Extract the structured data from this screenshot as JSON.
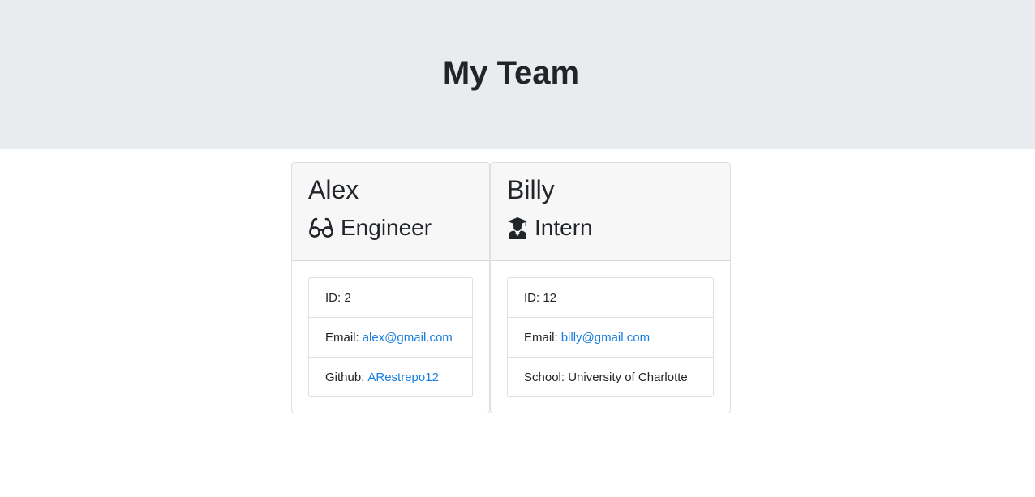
{
  "header": {
    "title": "My Team"
  },
  "members": [
    {
      "name": "Alex",
      "role": "Engineer",
      "role_icon": "glasses-icon",
      "fields": [
        {
          "label": "ID: 2",
          "value": ""
        },
        {
          "label": "Email:",
          "value": "alex@gmail.com"
        },
        {
          "label": "Github:",
          "value": "ARestrepo12"
        }
      ]
    },
    {
      "name": "Billy",
      "role": "Intern",
      "role_icon": "graduate-icon",
      "fields": [
        {
          "label": "ID: 12",
          "value": ""
        },
        {
          "label": "Email:",
          "value": "billy@gmail.com"
        },
        {
          "label": "School: University of Charlotte",
          "value": ""
        }
      ]
    }
  ],
  "colors": {
    "header_bg": "#e9ecef",
    "card_header_bg": "#f7f7f7",
    "link": "#1a7ee0",
    "text": "#212529"
  }
}
